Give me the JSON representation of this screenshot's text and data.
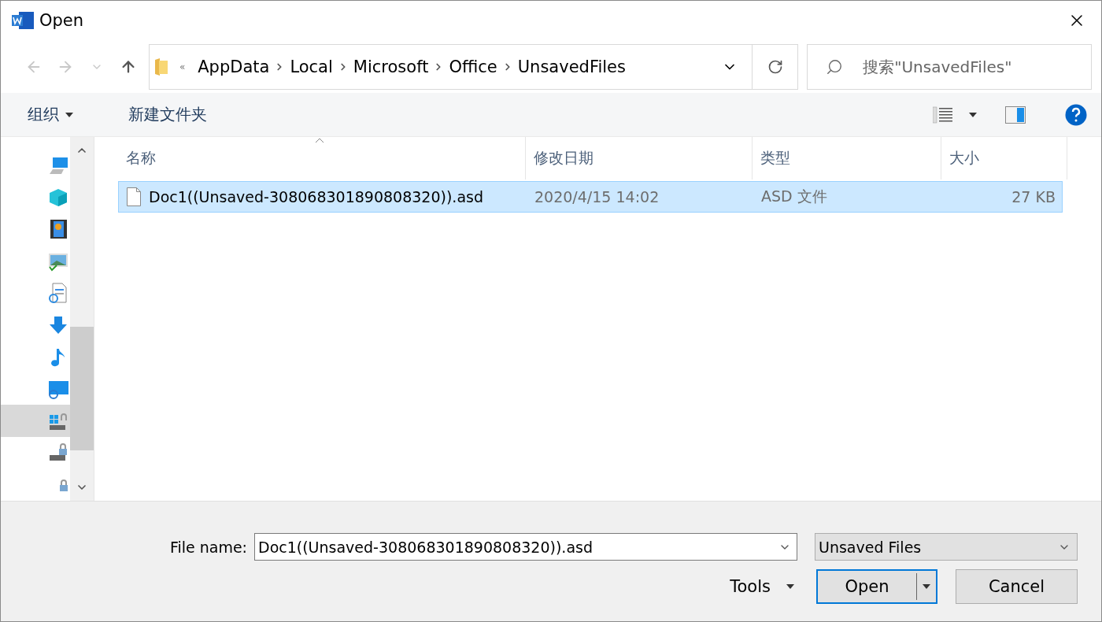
{
  "window": {
    "title": "Open"
  },
  "nav": {
    "overflow": "«",
    "breadcrumb": [
      "AppData",
      "Local",
      "Microsoft",
      "Office",
      "UnsavedFiles"
    ]
  },
  "search": {
    "placeholder": "搜索\"UnsavedFiles\""
  },
  "commands": {
    "organize": "组织",
    "new_folder": "新建文件夹"
  },
  "sidebar": {
    "items": [
      {
        "kind": "computer",
        "selected": false
      },
      {
        "kind": "cube",
        "selected": false
      },
      {
        "kind": "film",
        "selected": false
      },
      {
        "kind": "image",
        "selected": false
      },
      {
        "kind": "document",
        "selected": false
      },
      {
        "kind": "download",
        "selected": false
      },
      {
        "kind": "music",
        "selected": false
      },
      {
        "kind": "desktop",
        "selected": false
      },
      {
        "kind": "windows-drive",
        "selected": true
      },
      {
        "kind": "locked-drive",
        "selected": false
      },
      {
        "kind": "lock",
        "selected": false
      }
    ]
  },
  "table": {
    "columns": [
      "名称",
      "修改日期",
      "类型",
      "大小"
    ],
    "rows": [
      {
        "name": "Doc1((Unsaved-308068301890808320)).asd",
        "modified": "2020/4/15 14:02",
        "type": "ASD 文件",
        "size": "27 KB",
        "selected": true
      }
    ]
  },
  "footer": {
    "file_name_label": "File name:",
    "file_name": "Doc1((Unsaved-308068301890808320)).asd",
    "file_type": "Unsaved Files",
    "tools": "Tools",
    "open": "Open",
    "cancel": "Cancel"
  }
}
